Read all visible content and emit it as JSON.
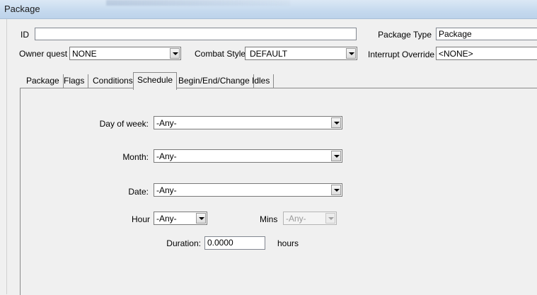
{
  "window": {
    "title": "Package"
  },
  "header": {
    "id_label": "ID",
    "id_value": "",
    "package_type_label": "Package Type",
    "package_type_value": "Package",
    "owner_quest_label": "Owner quest",
    "owner_quest_value": "NONE",
    "combat_style_label": "Combat Style",
    "combat_style_value": "DEFAULT",
    "interrupt_override_label": "Interrupt Override",
    "interrupt_override_value": "<NONE>"
  },
  "tabs": [
    {
      "label": "Package",
      "active": false
    },
    {
      "label": "Flags",
      "active": false
    },
    {
      "label": "Conditions",
      "active": false
    },
    {
      "label": "Schedule",
      "active": true
    },
    {
      "label": "Begin/End/Change",
      "active": false
    },
    {
      "label": "Idles",
      "active": false
    }
  ],
  "schedule": {
    "day_of_week_label": "Day of week:",
    "day_of_week_value": "-Any-",
    "month_label": "Month:",
    "month_value": "-Any-",
    "date_label": "Date:",
    "date_value": "-Any-",
    "hour_label": "Hour",
    "hour_value": "-Any-",
    "mins_label": "Mins",
    "mins_value": "-Any-",
    "duration_label": "Duration:",
    "duration_value": "0.0000",
    "duration_unit": "hours"
  }
}
